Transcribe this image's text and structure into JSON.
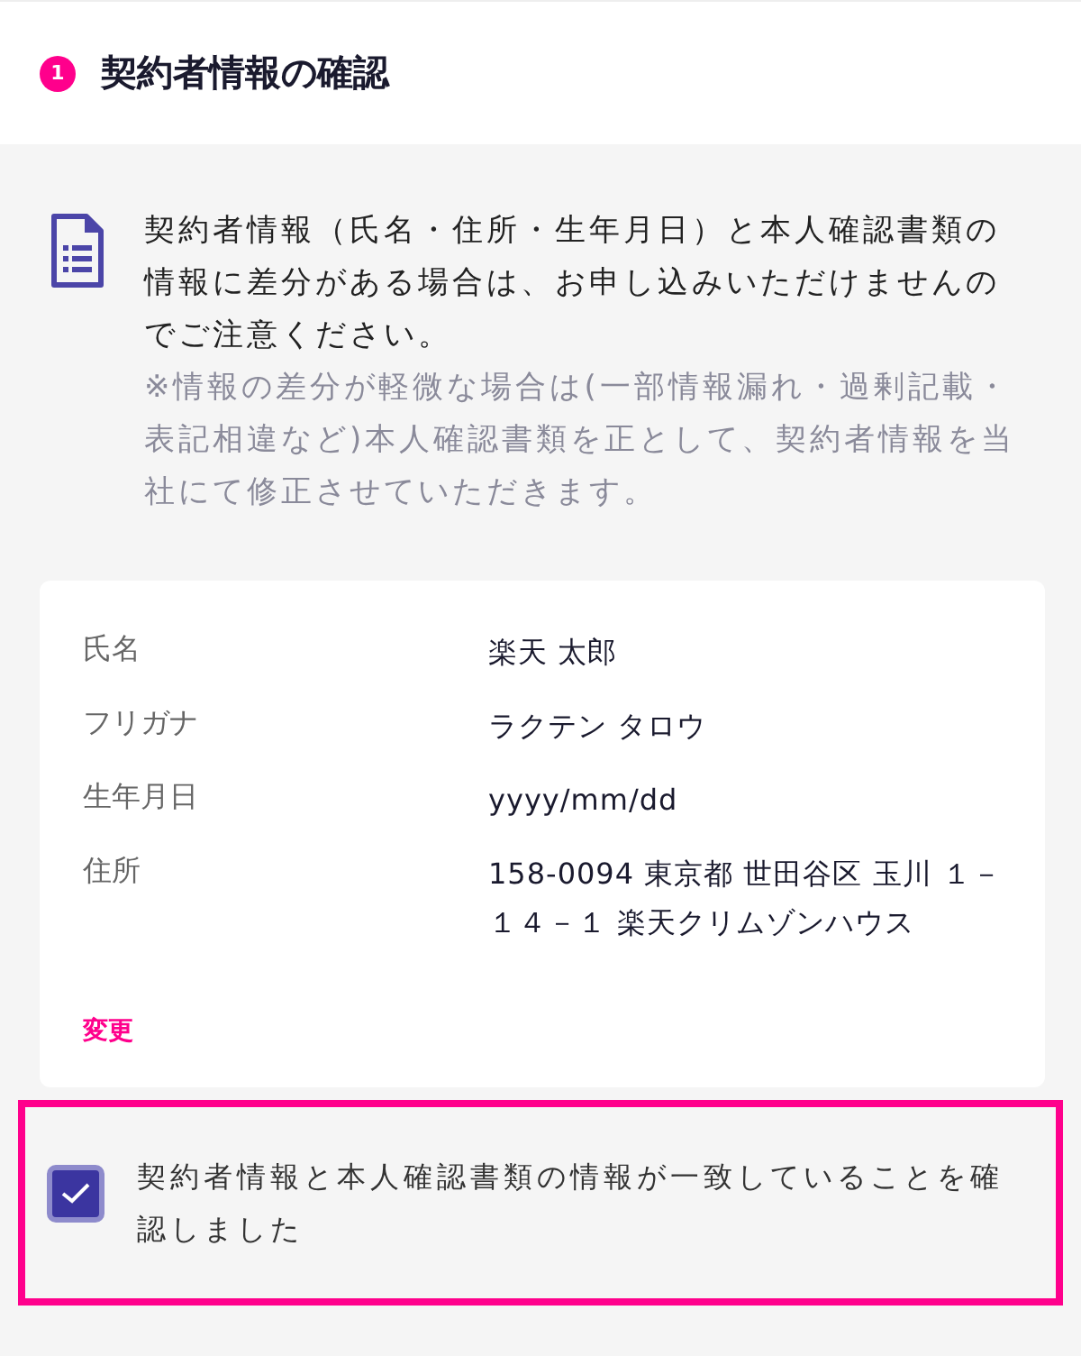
{
  "section": {
    "step": "1",
    "title": "契約者情報の確認"
  },
  "notice": {
    "text": "契約者情報（氏名・住所・生年月日）と本人確認書類の情報に差分がある場合は、お申し込みいただけませんのでご注意ください。",
    "note": "※情報の差分が軽微な場合は(一部情報漏れ・過剰記載・表記相違など)本人確認書類を正として、契約者情報を当社にて修正させていただきます。"
  },
  "details": [
    {
      "label": "氏名",
      "value": "楽天 太郎"
    },
    {
      "label": "フリガナ",
      "value": "ラクテン タロウ"
    },
    {
      "label": "生年月日",
      "value": "yyyy/mm/dd"
    },
    {
      "label": "住所",
      "value": "158-0094 東京都 世田谷区 玉川 １－１４－１ 楽天クリムゾンハウス"
    }
  ],
  "change_link": "変更",
  "confirmation": {
    "label": "契約者情報と本人確認書類の情報が一致していることを確認しました",
    "checked": true
  }
}
